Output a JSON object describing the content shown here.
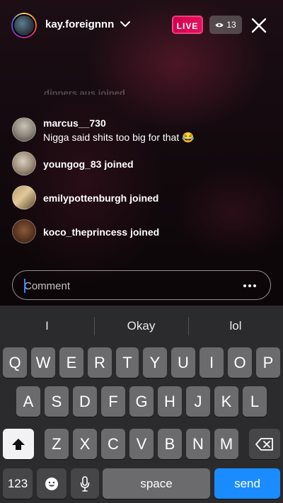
{
  "header": {
    "host_username": "kay.foreignnn",
    "live_label": "LIVE",
    "viewer_count": "13"
  },
  "comments": {
    "faded_partial": "dippers aus joined",
    "items": [
      {
        "username": "marcus__730",
        "text": "Nigga said shits too big for that 😂"
      },
      {
        "username": "youngog_83",
        "text": "joined"
      },
      {
        "username": "emilypottenburgh",
        "text": "joined"
      },
      {
        "username": "koco_theprincess",
        "text": "joined"
      }
    ]
  },
  "comment_input": {
    "placeholder": "Comment",
    "value": ""
  },
  "keyboard": {
    "suggestions": [
      "I",
      "Okay",
      "lol"
    ],
    "row1": [
      "Q",
      "W",
      "E",
      "R",
      "T",
      "Y",
      "U",
      "I",
      "O",
      "P"
    ],
    "row2": [
      "A",
      "S",
      "D",
      "F",
      "G",
      "H",
      "J",
      "K",
      "L"
    ],
    "row3": [
      "Z",
      "X",
      "C",
      "V",
      "B",
      "N",
      "M"
    ],
    "numbers_label": "123",
    "space_label": "space",
    "send_label": "send"
  },
  "colors": {
    "live_badge": "#d3004f",
    "send_key": "#1a8cff",
    "keyboard_bg": "#2b2b2d"
  },
  "icons": [
    "chevron-down-icon",
    "eye-icon",
    "close-icon",
    "more-icon",
    "shift-icon",
    "backspace-icon",
    "emoji-icon",
    "microphone-icon"
  ]
}
